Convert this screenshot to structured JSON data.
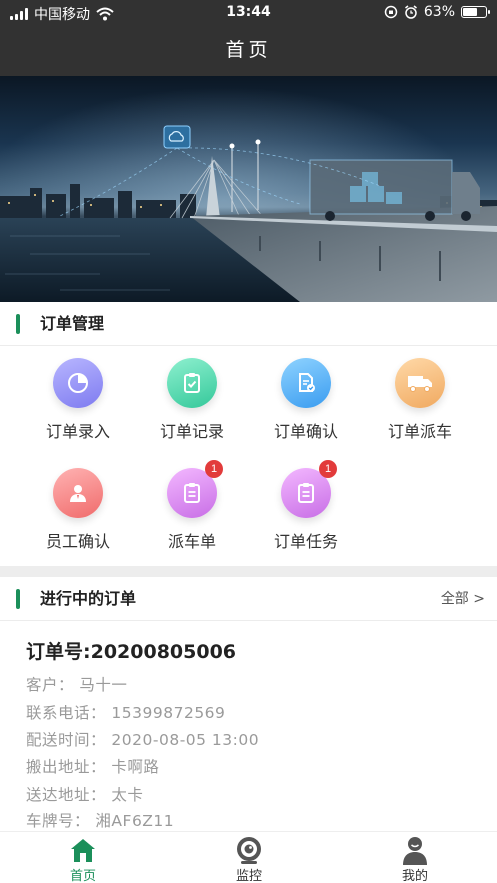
{
  "status_bar": {
    "carrier": "中国移动",
    "time": "13:44",
    "battery": "63%",
    "battery_level": 0.63
  },
  "nav": {
    "title": "首页"
  },
  "order_management": {
    "title": "订单管理",
    "items": [
      {
        "label": "订单录入",
        "icon": "pie-chart-icon",
        "color_top": "#b8b6ff",
        "color_bottom": "#7e7bf0",
        "badge": ""
      },
      {
        "label": "订单记录",
        "icon": "clipboard-check-icon",
        "color_top": "#8ef0cf",
        "color_bottom": "#34c89a",
        "badge": ""
      },
      {
        "label": "订单确认",
        "icon": "document-check-icon",
        "color_top": "#8fd3ff",
        "color_bottom": "#3a9cf0",
        "badge": ""
      },
      {
        "label": "订单派车",
        "icon": "truck-icon",
        "color_top": "#ffd9a8",
        "color_bottom": "#f0a960",
        "badge": ""
      },
      {
        "label": "员工确认",
        "icon": "person-icon",
        "color_top": "#ffb3b3",
        "color_bottom": "#f06b6b",
        "badge": ""
      },
      {
        "label": "派车单",
        "icon": "clipboard-list-icon",
        "color_top": "#f3b8ff",
        "color_bottom": "#c86ee6",
        "badge": "1"
      },
      {
        "label": "订单任务",
        "icon": "clipboard-list-icon",
        "color_top": "#f3b8ff",
        "color_bottom": "#c86ee6",
        "badge": "1"
      }
    ]
  },
  "ongoing_orders": {
    "title": "进行中的订单",
    "more": "全部 >",
    "order": {
      "number": "订单号:20200805006",
      "customer": "客户：  马十一",
      "phone": "联系电话：  15399872569",
      "delivery_time": "配送时间：  2020-08-05 13:00",
      "pickup_address": "搬出地址：  卡啊路",
      "delivery_address": "送达地址：  太卡",
      "plate": "车牌号：  湘AF6Z11"
    }
  },
  "tab_bar": {
    "tabs": [
      {
        "label": "首页",
        "icon": "home-icon",
        "active": true
      },
      {
        "label": "监控",
        "icon": "camera-icon",
        "active": false
      },
      {
        "label": "我的",
        "icon": "user-icon",
        "active": false
      }
    ]
  },
  "colors": {
    "accent": "#1b8f5a",
    "dark_header": "#323232",
    "badge": "#e23b3b"
  }
}
